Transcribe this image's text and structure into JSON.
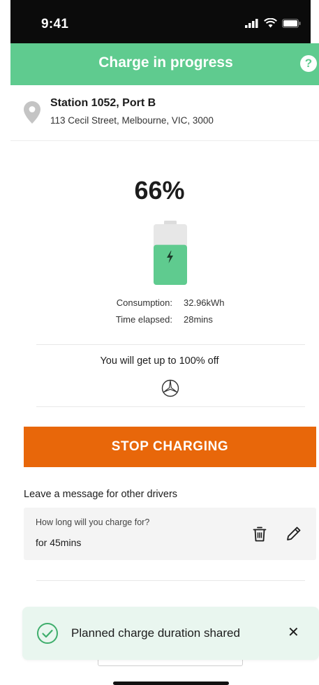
{
  "status_bar": {
    "time": "9:41",
    "icons": [
      "signal-icon",
      "wifi-icon",
      "battery-icon"
    ]
  },
  "header": {
    "title": "Charge in progress",
    "help_label": "?"
  },
  "station": {
    "name": "Station 1052, Port B",
    "address": "113 Cecil Street, Melbourne, VIC, 3000",
    "icon": "location-pin-icon"
  },
  "charge": {
    "percent_label": "66%",
    "level": 0.66,
    "consumption_label": "Consumption:",
    "consumption_value": "32.96kWh",
    "elapsed_label": "Time elapsed:",
    "elapsed_value": "28mins"
  },
  "offer": {
    "text": "You will get up to 100% off",
    "brand_icon": "mercedes-logo-icon"
  },
  "stop_button": {
    "label": "STOP CHARGING"
  },
  "message": {
    "heading": "Leave a message for other drivers",
    "question": "How long will you charge for?",
    "answer": "for 45mins"
  },
  "toast": {
    "text": "Planned charge duration shared",
    "close_label": "✕"
  },
  "colors": {
    "brand_green": "#5fcb8f",
    "stop_orange": "#e8670a",
    "toast_bg": "#e9f6ef",
    "battery_fill": "#5fcb8f"
  }
}
